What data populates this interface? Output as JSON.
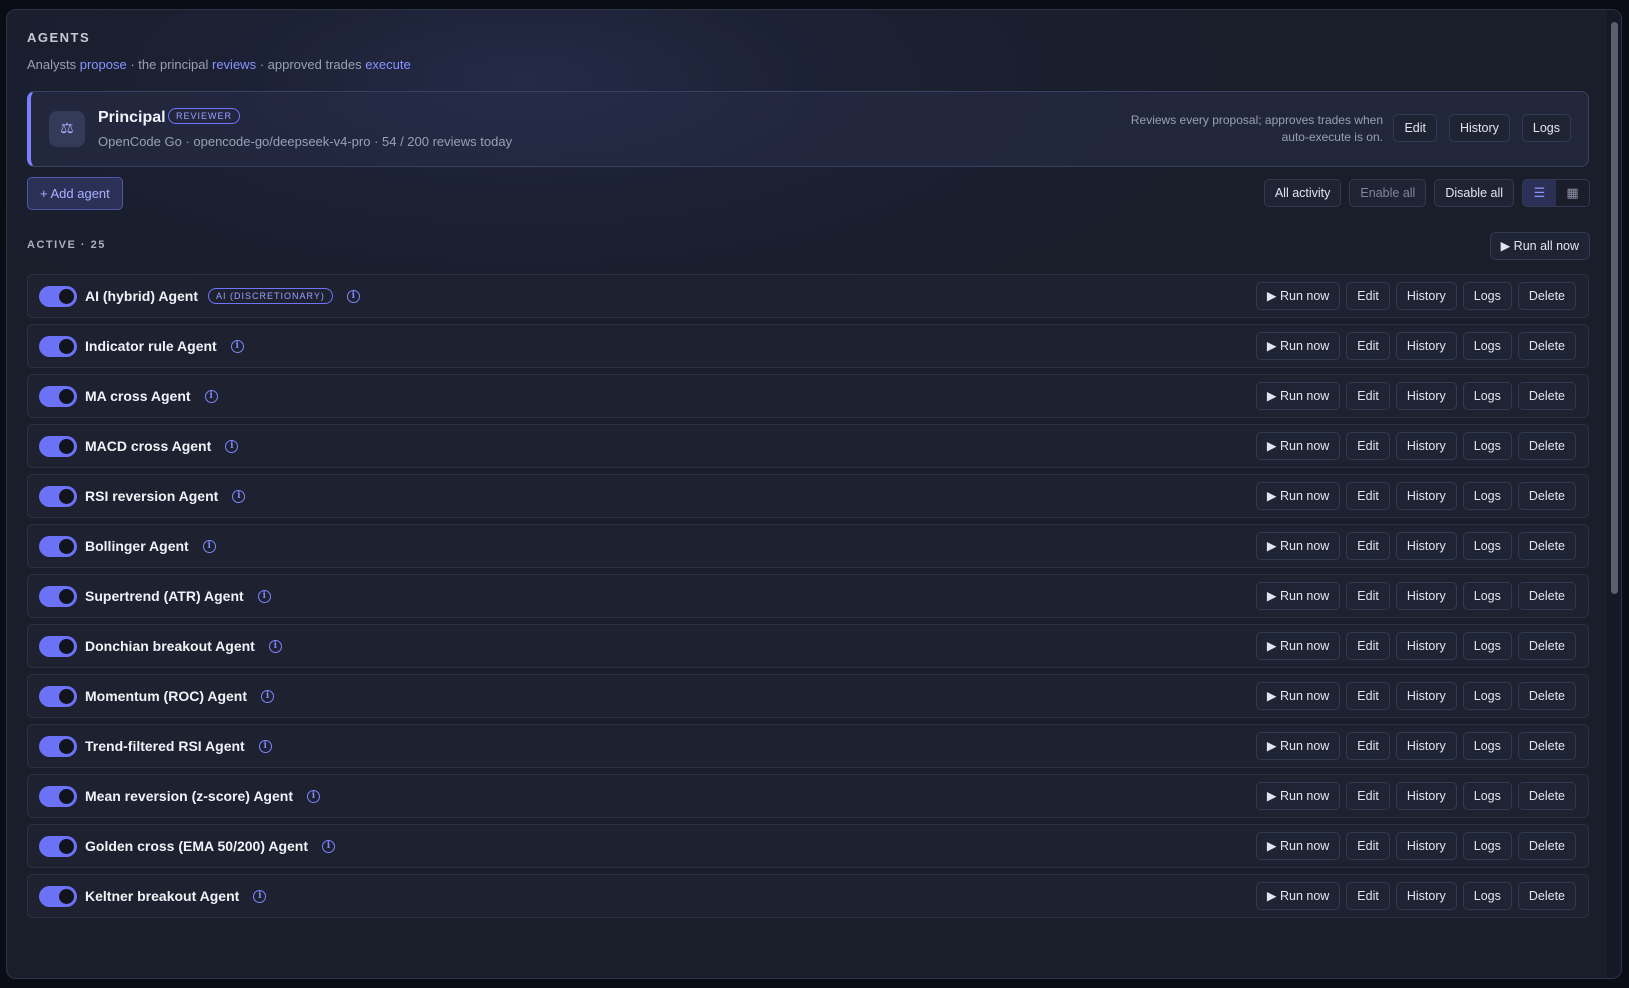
{
  "header": {
    "title": "AGENTS",
    "tagline": {
      "t1": "Analysts ",
      "w1": "propose",
      "t2": " · the principal ",
      "w2": "reviews",
      "t3": " · approved trades ",
      "w3": "execute"
    }
  },
  "principal": {
    "icon": "scales-icon",
    "icon_glyph": "⚖",
    "name": "Principal",
    "badge": "REVIEWER",
    "meta": "OpenCode Go · opencode-go/deepseek-v4-pro · 54 / 200 reviews today",
    "description": "Reviews every proposal; approves trades when auto-execute is on.",
    "buttons": {
      "edit": "Edit",
      "history": "History",
      "logs": "Logs"
    }
  },
  "toolbar": {
    "add_agent": "+ Add agent",
    "all_activity": "All activity",
    "enable_all": "Enable all",
    "disable_all": "Disable all",
    "view_list_glyph": "☰",
    "view_grid_glyph": "▦",
    "view_mode": "list"
  },
  "active": {
    "label": "ACTIVE · 25",
    "run_all": "▶ Run all now"
  },
  "row_buttons": {
    "run_now": "▶ Run now",
    "edit": "Edit",
    "history": "History",
    "logs": "Logs",
    "delete": "Delete"
  },
  "agents": [
    {
      "name": "AI (hybrid) Agent",
      "badge": "AI (DISCRETIONARY)",
      "enabled": true
    },
    {
      "name": "Indicator rule Agent",
      "enabled": true
    },
    {
      "name": "MA cross Agent",
      "enabled": true
    },
    {
      "name": "MACD cross Agent",
      "enabled": true
    },
    {
      "name": "RSI reversion Agent",
      "enabled": true
    },
    {
      "name": "Bollinger Agent",
      "enabled": true
    },
    {
      "name": "Supertrend (ATR) Agent",
      "enabled": true
    },
    {
      "name": "Donchian breakout Agent",
      "enabled": true
    },
    {
      "name": "Momentum (ROC) Agent",
      "enabled": true
    },
    {
      "name": "Trend-filtered RSI Agent",
      "enabled": true
    },
    {
      "name": "Mean reversion (z-score) Agent",
      "enabled": true
    },
    {
      "name": "Golden cross (EMA 50/200) Agent",
      "enabled": true
    },
    {
      "name": "Keltner breakout Agent",
      "enabled": true
    }
  ],
  "colors": {
    "accent": "#7c80ff",
    "toggle_on": "#6b72f5",
    "background": "#1a1e2b"
  }
}
